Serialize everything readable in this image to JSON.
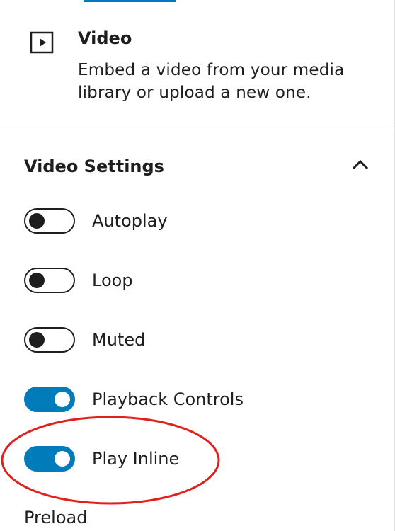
{
  "block": {
    "icon": "video-play-icon",
    "title": "Video",
    "description": "Embed a video from your media library or upload a new one."
  },
  "settings": {
    "title": "Video Settings",
    "collapse_icon": "chevron-up-icon",
    "toggles": [
      {
        "label": "Autoplay",
        "enabled": false
      },
      {
        "label": "Loop",
        "enabled": false
      },
      {
        "label": "Muted",
        "enabled": false
      },
      {
        "label": "Playback Controls",
        "enabled": true
      },
      {
        "label": "Play Inline",
        "enabled": true
      }
    ],
    "preload_label": "Preload"
  },
  "colors": {
    "accent": "#007cba",
    "text": "#1e1e1e",
    "annotation": "#e0201b"
  }
}
